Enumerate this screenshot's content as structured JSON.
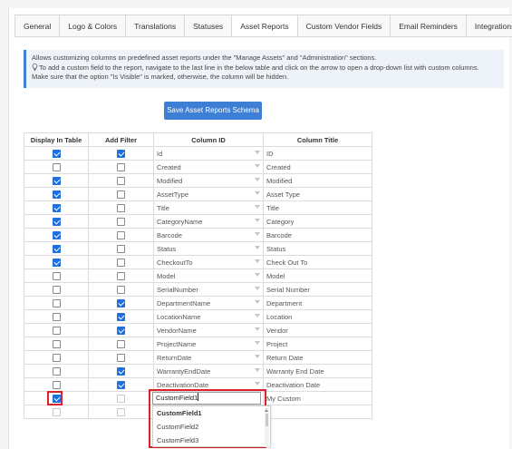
{
  "tabs": [
    "General",
    "Logo & Colors",
    "Translations",
    "Statuses",
    "Asset Reports",
    "Custom Vendor Fields",
    "Email Reminders",
    "Integrations"
  ],
  "active_tab": "Asset Reports",
  "info": {
    "line1": "Allows customizing columns on predefined asset reports under the \"Manage Assets\" and \"Administration\" sections.",
    "line2": "To add a custom field to the report, navigate to the last line in the below table and click on the arrow to open a drop-down list with custom columns.",
    "line3": "Make sure that the option \"Is Visible\" is marked, otherwise, the column will be hidden."
  },
  "save_button": "Save Asset Reports Schema",
  "table": {
    "headers": [
      "Display In Table",
      "Add Filter",
      "Column ID",
      "Column Title"
    ],
    "rows": [
      {
        "display": true,
        "filter": true,
        "id": "Id",
        "title": "ID"
      },
      {
        "display": false,
        "filter": false,
        "id": "Created",
        "title": "Created"
      },
      {
        "display": true,
        "filter": false,
        "id": "Modified",
        "title": "Modified"
      },
      {
        "display": true,
        "filter": false,
        "id": "AssetType",
        "title": "Asset Type"
      },
      {
        "display": true,
        "filter": false,
        "id": "Title",
        "title": "Title"
      },
      {
        "display": true,
        "filter": false,
        "id": "CategoryName",
        "title": "Category"
      },
      {
        "display": true,
        "filter": false,
        "id": "Barcode",
        "title": "Barcode"
      },
      {
        "display": true,
        "filter": false,
        "id": "Status",
        "title": "Status"
      },
      {
        "display": true,
        "filter": false,
        "id": "CheckoutTo",
        "title": "Check Out To"
      },
      {
        "display": false,
        "filter": false,
        "id": "Model",
        "title": "Model"
      },
      {
        "display": false,
        "filter": false,
        "id": "SerialNumber",
        "title": "Serial Number"
      },
      {
        "display": false,
        "filter": true,
        "id": "DepartmentName",
        "title": "Department"
      },
      {
        "display": false,
        "filter": true,
        "id": "LocationName",
        "title": "Location"
      },
      {
        "display": false,
        "filter": true,
        "id": "VendorName",
        "title": "Vendor"
      },
      {
        "display": false,
        "filter": false,
        "id": "ProjectName",
        "title": "Project"
      },
      {
        "display": false,
        "filter": false,
        "id": "ReturnDate",
        "title": "Return Date"
      },
      {
        "display": false,
        "filter": true,
        "id": "WarrantyEndDate",
        "title": "Warranty End Date"
      },
      {
        "display": false,
        "filter": true,
        "id": "DeactivationDate",
        "title": "Deactivation Date"
      }
    ],
    "custom_row": {
      "display": true,
      "filter": false,
      "id_input": "CustomField1",
      "title": "My Custom"
    }
  },
  "dropdown_options": [
    "CustomField1",
    "CustomField2",
    "CustomField3"
  ],
  "colors": {
    "accent": "#3d7fd4",
    "checkbox": "#1f6fdc",
    "highlight": "#e0202a"
  }
}
